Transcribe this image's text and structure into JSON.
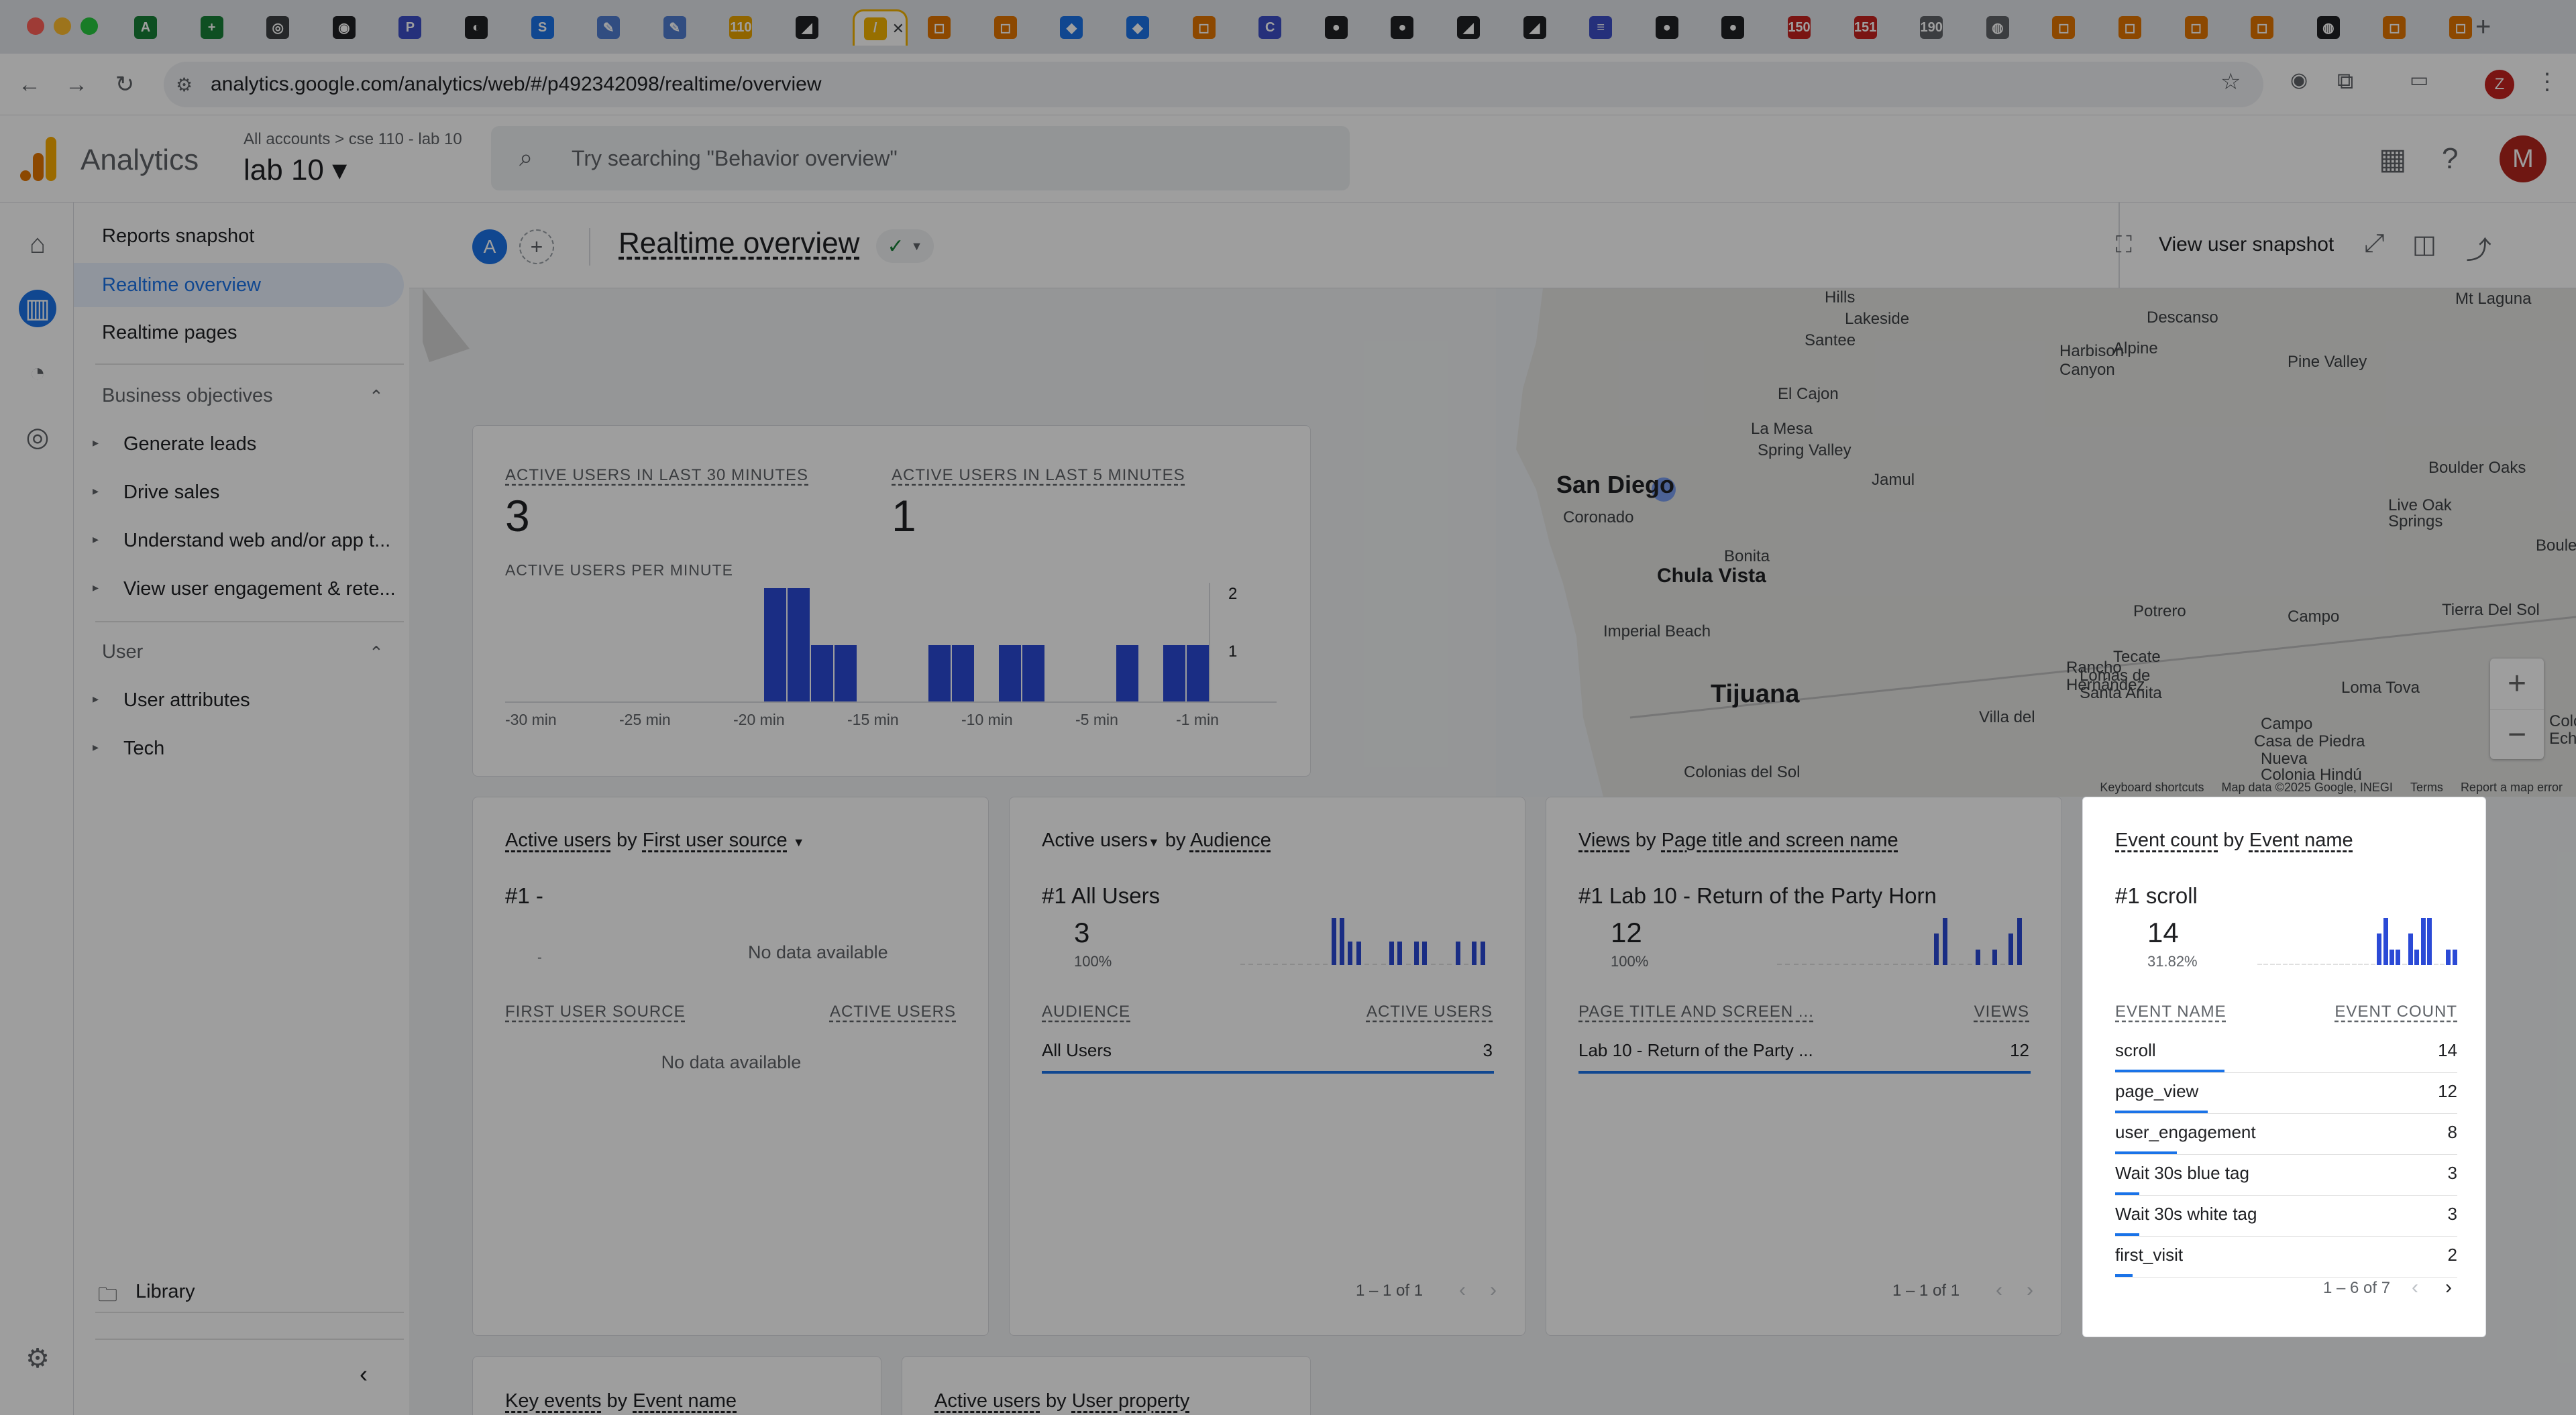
{
  "browser": {
    "tabs": [
      {
        "favicon": "A",
        "color": "#188038"
      },
      {
        "favicon": "+",
        "color": "#188038"
      },
      {
        "favicon": "◎",
        "color": "#3c4043"
      },
      {
        "favicon": "◉",
        "color": "#202124"
      },
      {
        "favicon": "P",
        "color": "#3c4ec7"
      },
      {
        "favicon": "◐",
        "color": "#202124"
      },
      {
        "favicon": "S",
        "color": "#1a73e8"
      },
      {
        "favicon": "✎",
        "color": "#4f7cd1"
      },
      {
        "favicon": "✎",
        "color": "#4f7cd1"
      },
      {
        "favicon": "110",
        "color": "#e8a400"
      },
      {
        "favicon": "◢",
        "color": "#202124"
      },
      {
        "favicon": "/",
        "color": "#f4b400"
      },
      {
        "favicon": "◻",
        "color": "#e37400"
      },
      {
        "favicon": "◻",
        "color": "#e37400"
      },
      {
        "favicon": "◆",
        "color": "#1a73e8"
      },
      {
        "favicon": "◆",
        "color": "#1a73e8"
      },
      {
        "favicon": "◻",
        "color": "#e37400"
      },
      {
        "favicon": "C",
        "color": "#3c4ec7"
      },
      {
        "favicon": "●",
        "color": "#202124"
      },
      {
        "favicon": "●",
        "color": "#202124"
      },
      {
        "favicon": "◢",
        "color": "#202124"
      },
      {
        "favicon": "◢",
        "color": "#202124"
      },
      {
        "favicon": "≡",
        "color": "#3c4ec7"
      },
      {
        "favicon": "●",
        "color": "#202124"
      },
      {
        "favicon": "●",
        "color": "#202124"
      },
      {
        "favicon": "150",
        "color": "#c5221f"
      },
      {
        "favicon": "151",
        "color": "#c5221f"
      },
      {
        "favicon": "190",
        "color": "#5f6368"
      },
      {
        "favicon": "◍",
        "color": "#5f6368"
      },
      {
        "favicon": "◻",
        "color": "#e37400"
      },
      {
        "favicon": "◻",
        "color": "#e37400"
      },
      {
        "favicon": "◻",
        "color": "#e37400"
      },
      {
        "favicon": "◻",
        "color": "#e37400"
      },
      {
        "favicon": "◍",
        "color": "#202124"
      },
      {
        "favicon": "◻",
        "color": "#e37400"
      },
      {
        "favicon": "◻",
        "color": "#e37400"
      }
    ],
    "url": "analytics.google.com/analytics/web/#/p492342098/realtime/overview",
    "profile_initial": "Z"
  },
  "header": {
    "app_name": "Analytics",
    "breadcrumb": "All accounts > cse 110 - lab 10",
    "property": "lab 10 ▾",
    "search_placeholder": "Try searching \"Behavior overview\"",
    "avatar_initial": "M"
  },
  "nav": {
    "reports_snapshot": "Reports snapshot",
    "realtime_overview": "Realtime overview",
    "realtime_pages": "Realtime pages",
    "business_objectives": "Business objectives",
    "generate_leads": "Generate leads",
    "drive_sales": "Drive sales",
    "understand": "Understand web and/or app t...",
    "view_engagement": "View user engagement & rete...",
    "user_section": "User",
    "user_attributes": "User attributes",
    "tech": "Tech",
    "library": "Library"
  },
  "page": {
    "title": "Realtime overview",
    "compare_avatar": "A",
    "view_snapshot": "View user snapshot"
  },
  "map": {
    "labels": [
      "Hills",
      "Lakeside",
      "Santee",
      "Descanso",
      "Mt Laguna",
      "Harbison",
      "Canyon",
      "Alpine",
      "Pine Valley",
      "El Cajon",
      "La Mesa",
      "Spring Valley",
      "San Diego",
      "Coronado",
      "Jamul",
      "Boulder Oaks",
      "Live Oak",
      "Springs",
      "Boulevard",
      "Bonita",
      "Chula Vista",
      "Potrero",
      "Campo",
      "Tierra Del Sol",
      "Imperial Beach",
      "Tecate",
      "Lomas de",
      "Santa Anita",
      "Rancho",
      "Hernández",
      "Tijuana",
      "Villa del",
      "Campo",
      "Casa de Piedra",
      "Nueva",
      "Colonia Hindú",
      "Loma Tova",
      "Colonias del Sol",
      "Colon",
      "Eche"
    ],
    "attribution": [
      "Keyboard shortcuts",
      "Map data ©2025 Google, INEGI",
      "Terms",
      "Report a map error"
    ]
  },
  "active_users_card": {
    "label_30": "ACTIVE USERS IN LAST 30 MINUTES",
    "value_30": "3",
    "label_5": "ACTIVE USERS IN LAST 5 MINUTES",
    "value_5": "1",
    "per_minute_label": "ACTIVE USERS PER MINUTE",
    "y_ticks": [
      "2",
      "1"
    ],
    "x_ticks": [
      "-30 min",
      "-25 min",
      "-20 min",
      "-15 min",
      "-10 min",
      "-5 min",
      "-1 min"
    ]
  },
  "chart_data": {
    "type": "bar",
    "title": "ACTIVE USERS PER MINUTE",
    "categories": [
      "-30",
      "-29",
      "-28",
      "-27",
      "-26",
      "-25",
      "-24",
      "-23",
      "-22",
      "-21",
      "-20",
      "-19",
      "-18",
      "-17",
      "-16",
      "-15",
      "-14",
      "-13",
      "-12",
      "-11",
      "-10",
      "-9",
      "-8",
      "-7",
      "-6",
      "-5",
      "-4",
      "-3",
      "-2",
      "-1"
    ],
    "values": [
      0,
      0,
      0,
      0,
      0,
      0,
      0,
      0,
      0,
      0,
      0,
      2,
      2,
      1,
      1,
      0,
      0,
      0,
      1,
      1,
      0,
      1,
      1,
      0,
      0,
      0,
      1,
      0,
      1,
      1
    ],
    "ylim": [
      0,
      2
    ]
  },
  "source_card": {
    "metric": "Active users",
    "by": " by ",
    "dimension": "First user source",
    "rank": "#1  -",
    "dash": "-",
    "no_data_top": "No data available",
    "col1": "FIRST USER SOURCE",
    "col2": "ACTIVE USERS",
    "no_data": "No data available"
  },
  "audience_card": {
    "metric": "Active users",
    "by": " by ",
    "dimension": "Audience",
    "rank": "#1  All Users",
    "value": "3",
    "pct": "100%",
    "col1": "AUDIENCE",
    "col2": "ACTIVE USERS",
    "row_label": "All Users",
    "row_value": "3",
    "pager": "1 – 1 of 1",
    "spark": [
      0,
      0,
      0,
      0,
      0,
      0,
      0,
      0,
      0,
      0,
      0,
      2,
      2,
      1,
      1,
      0,
      0,
      0,
      1,
      1,
      0,
      1,
      1,
      0,
      0,
      0,
      1,
      0,
      1,
      1
    ]
  },
  "views_card": {
    "metric": "Views",
    "by": " by ",
    "dimension": "Page title and screen name",
    "rank": "#1  Lab 10 - Return of the Party Horn",
    "value": "12",
    "pct": "100%",
    "col1": "PAGE TITLE AND SCREEN ...",
    "col2": "VIEWS",
    "row_label": "Lab 10 - Return of the Party ...",
    "row_value": "12",
    "pager": "1 – 1 of 1",
    "spark": [
      0,
      0,
      0,
      0,
      0,
      0,
      0,
      0,
      0,
      0,
      0,
      0,
      0,
      0,
      0,
      0,
      0,
      0,
      0,
      2,
      3,
      0,
      0,
      0,
      1,
      0,
      1,
      0,
      2,
      3
    ]
  },
  "event_card": {
    "metric": "Event count",
    "by": " by ",
    "dimension": "Event name",
    "rank": "#1  scroll",
    "value": "14",
    "pct": "31.82%",
    "col1": "EVENT NAME",
    "col2": "EVENT COUNT",
    "rows": [
      {
        "name": "scroll",
        "count": "14",
        "share": 0.32
      },
      {
        "name": "page_view",
        "count": "12",
        "share": 0.27
      },
      {
        "name": "user_engagement",
        "count": "8",
        "share": 0.18
      },
      {
        "name": "Wait 30s blue tag",
        "count": "3",
        "share": 0.07
      },
      {
        "name": "Wait 30s white tag",
        "count": "3",
        "share": 0.07
      },
      {
        "name": "first_visit",
        "count": "2",
        "share": 0.05
      }
    ],
    "pager": "1 – 6 of 7",
    "spark": [
      0,
      0,
      0,
      0,
      0,
      0,
      0,
      0,
      0,
      0,
      0,
      0,
      0,
      0,
      0,
      0,
      0,
      0,
      0,
      2,
      3,
      1,
      1,
      0,
      2,
      1,
      3,
      3,
      0,
      0,
      1,
      1
    ]
  },
  "bottom_cards": {
    "key_events_metric": "Key events",
    "key_events_dim": "Event name",
    "user_prop_metric": "Active users",
    "user_prop_dim": "User property"
  }
}
